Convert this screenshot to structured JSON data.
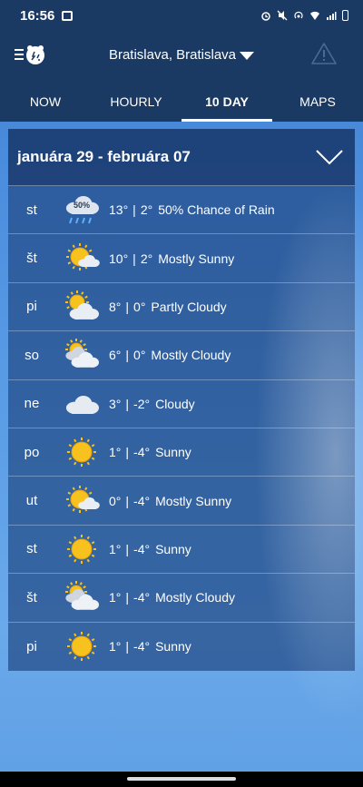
{
  "status": {
    "time": "16:56"
  },
  "header": {
    "location": "Bratislava, Bratislava"
  },
  "tabs": [
    {
      "label": "NOW",
      "active": false
    },
    {
      "label": "HOURLY",
      "active": false
    },
    {
      "label": "10 DAY",
      "active": true
    },
    {
      "label": "MAPS",
      "active": false
    }
  ],
  "forecast": {
    "range": "januára 29 - februára 07",
    "days": [
      {
        "day": "st",
        "high": "13°",
        "low": "2°",
        "condition": "50% Chance of Rain",
        "icon": "rain-cloud-icon",
        "badge": "50%"
      },
      {
        "day": "št",
        "high": "10°",
        "low": "2°",
        "condition": "Mostly Sunny",
        "icon": "mostly-sunny-icon"
      },
      {
        "day": "pi",
        "high": "8°",
        "low": "0°",
        "condition": "Partly Cloudy",
        "icon": "partly-cloudy-icon"
      },
      {
        "day": "so",
        "high": "6°",
        "low": "0°",
        "condition": "Mostly Cloudy",
        "icon": "mostly-cloudy-icon"
      },
      {
        "day": "ne",
        "high": "3°",
        "low": "-2°",
        "condition": "Cloudy",
        "icon": "cloudy-icon"
      },
      {
        "day": "po",
        "high": "1°",
        "low": "-4°",
        "condition": "Sunny",
        "icon": "sunny-icon"
      },
      {
        "day": "ut",
        "high": "0°",
        "low": "-4°",
        "condition": "Mostly Sunny",
        "icon": "mostly-sunny-icon"
      },
      {
        "day": "st",
        "high": "1°",
        "low": "-4°",
        "condition": "Sunny",
        "icon": "sunny-icon"
      },
      {
        "day": "št",
        "high": "1°",
        "low": "-4°",
        "condition": "Mostly Cloudy",
        "icon": "mostly-cloudy-icon"
      },
      {
        "day": "pi",
        "high": "1°",
        "low": "-4°",
        "condition": "Sunny",
        "icon": "sunny-icon"
      }
    ]
  },
  "colors": {
    "header_bg": "#1b3a63",
    "sun": "#f7c21d"
  }
}
